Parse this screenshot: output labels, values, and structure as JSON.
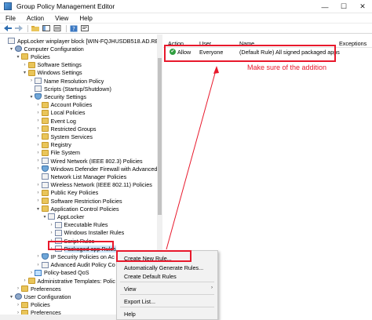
{
  "window": {
    "title": "Group Policy Management Editor",
    "minimize": "—",
    "maximize": "☐",
    "close": "✕"
  },
  "menu": [
    "File",
    "Action",
    "View",
    "Help"
  ],
  "tree": {
    "items": [
      {
        "label": "AppLocker winplayer block [WIN-FQJHUSDB518.AD.REM-SYSTE",
        "indent": 0,
        "expander": "",
        "icon": "doc"
      },
      {
        "label": "Computer Configuration",
        "indent": 1,
        "expander": "▾",
        "icon": "gear"
      },
      {
        "label": "Policies",
        "indent": 2,
        "expander": "▾",
        "icon": "folder"
      },
      {
        "label": "Software Settings",
        "indent": 3,
        "expander": "›",
        "icon": "folder"
      },
      {
        "label": "Windows Settings",
        "indent": 3,
        "expander": "▾",
        "icon": "folder"
      },
      {
        "label": "Name Resolution Policy",
        "indent": 4,
        "expander": "›",
        "icon": "doc"
      },
      {
        "label": "Scripts (Startup/Shutdown)",
        "indent": 4,
        "expander": "",
        "icon": "doc"
      },
      {
        "label": "Security Settings",
        "indent": 4,
        "expander": "▾",
        "icon": "shield"
      },
      {
        "label": "Account Policies",
        "indent": 5,
        "expander": "›",
        "icon": "folder"
      },
      {
        "label": "Local Policies",
        "indent": 5,
        "expander": "›",
        "icon": "folder"
      },
      {
        "label": "Event Log",
        "indent": 5,
        "expander": "›",
        "icon": "folder"
      },
      {
        "label": "Restricted Groups",
        "indent": 5,
        "expander": "›",
        "icon": "folder"
      },
      {
        "label": "System Services",
        "indent": 5,
        "expander": "›",
        "icon": "folder"
      },
      {
        "label": "Registry",
        "indent": 5,
        "expander": "›",
        "icon": "folder"
      },
      {
        "label": "File System",
        "indent": 5,
        "expander": "›",
        "icon": "folder"
      },
      {
        "label": "Wired Network (IEEE 802.3) Policies",
        "indent": 5,
        "expander": "›",
        "icon": "doc"
      },
      {
        "label": "Windows Defender Firewall with Advanced Se",
        "indent": 5,
        "expander": "›",
        "icon": "shield"
      },
      {
        "label": "Network List Manager Policies",
        "indent": 5,
        "expander": "",
        "icon": "doc"
      },
      {
        "label": "Wireless Network (IEEE 802.11) Policies",
        "indent": 5,
        "expander": "›",
        "icon": "doc"
      },
      {
        "label": "Public Key Policies",
        "indent": 5,
        "expander": "›",
        "icon": "folder"
      },
      {
        "label": "Software Restriction Policies",
        "indent": 5,
        "expander": "›",
        "icon": "folder"
      },
      {
        "label": "Application Control Policies",
        "indent": 5,
        "expander": "▾",
        "icon": "folder"
      },
      {
        "label": "AppLocker",
        "indent": 6,
        "expander": "▾",
        "icon": "doc"
      },
      {
        "label": "Executable Rules",
        "indent": 7,
        "expander": "›",
        "icon": "doc"
      },
      {
        "label": "Windows Installer Rules",
        "indent": 7,
        "expander": "›",
        "icon": "doc"
      },
      {
        "label": "Script Rules",
        "indent": 7,
        "expander": "›",
        "icon": "doc"
      },
      {
        "label": "Packaged app Rules",
        "indent": 7,
        "expander": "›",
        "icon": "doc",
        "selected": true
      },
      {
        "label": "IP Security Policies on Ac",
        "indent": 5,
        "expander": "›",
        "icon": "shield"
      },
      {
        "label": "Advanced Audit Policy Co",
        "indent": 5,
        "expander": "›",
        "icon": "doc"
      },
      {
        "label": "Policy-based QoS",
        "indent": 4,
        "expander": "›",
        "icon": "chart"
      },
      {
        "label": "Administrative Templates: Polic",
        "indent": 3,
        "expander": "›",
        "icon": "folder"
      },
      {
        "label": "Preferences",
        "indent": 2,
        "expander": "›",
        "icon": "folder"
      },
      {
        "label": "User Configuration",
        "indent": 1,
        "expander": "▾",
        "icon": "gear"
      },
      {
        "label": "Policies",
        "indent": 2,
        "expander": "›",
        "icon": "folder"
      },
      {
        "label": "Preferences",
        "indent": 2,
        "expander": "›",
        "icon": "folder"
      }
    ]
  },
  "list": {
    "columns": [
      "Action",
      "User",
      "Name",
      "Exceptions"
    ],
    "rows": [
      {
        "action": "Allow",
        "user": "Everyone",
        "name": "(Default Rule) All signed packaged apps",
        "exceptions": ""
      }
    ]
  },
  "annotation": "Make sure of the addition",
  "context_menu": {
    "items": [
      {
        "label": "Create New Rule...",
        "arrow": ""
      },
      {
        "label": "Automatically Generate Rules...",
        "arrow": ""
      },
      {
        "label": "Create Default Rules",
        "arrow": ""
      },
      {
        "label": "View",
        "arrow": "›"
      },
      {
        "label": "Export List...",
        "arrow": ""
      },
      {
        "label": "Help",
        "arrow": ""
      }
    ]
  },
  "colors": {
    "highlight_red": "#e8192c",
    "allow_green": "#2f9e3f",
    "selection": "#cce4f7"
  }
}
